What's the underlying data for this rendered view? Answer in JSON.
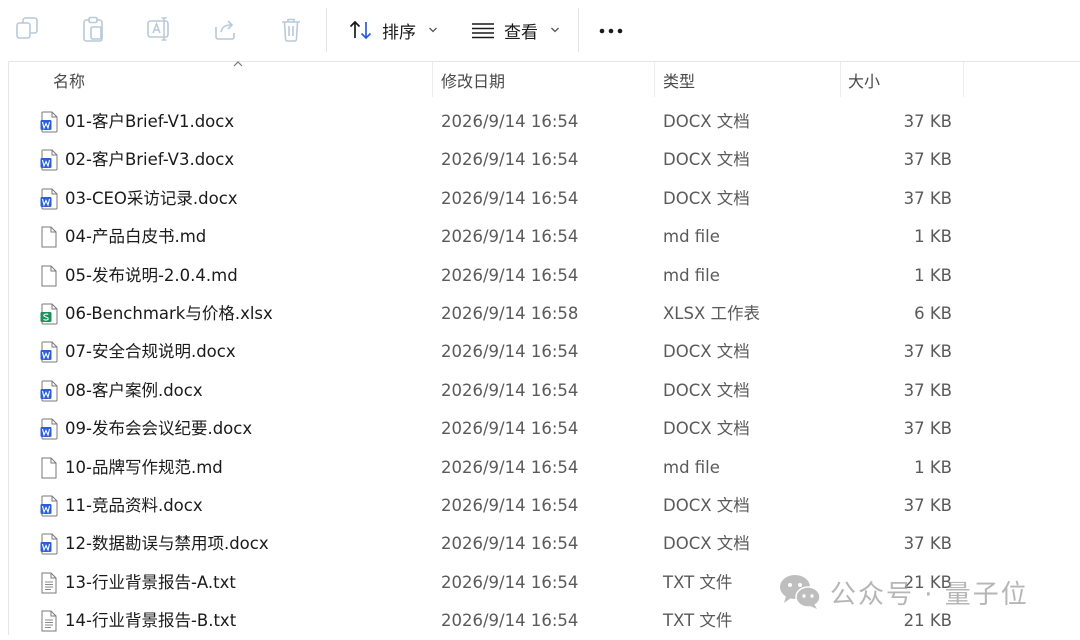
{
  "toolbar": {
    "sort_label": "排序",
    "view_label": "查看"
  },
  "columns": {
    "name": "名称",
    "modified": "修改日期",
    "type": "类型",
    "size": "大小"
  },
  "files": [
    {
      "name": "01-客户Brief-V1.docx",
      "modified": "2026/9/14 16:54",
      "type": "DOCX 文档",
      "size": "37 KB",
      "icon": "word-doc-icon"
    },
    {
      "name": "02-客户Brief-V3.docx",
      "modified": "2026/9/14 16:54",
      "type": "DOCX 文档",
      "size": "37 KB",
      "icon": "word-doc-icon"
    },
    {
      "name": "03-CEO采访记录.docx",
      "modified": "2026/9/14 16:54",
      "type": "DOCX 文档",
      "size": "37 KB",
      "icon": "word-doc-icon"
    },
    {
      "name": "04-产品白皮书.md",
      "modified": "2026/9/14 16:54",
      "type": "md file",
      "size": "1 KB",
      "icon": "blank-file-icon"
    },
    {
      "name": "05-发布说明-2.0.4.md",
      "modified": "2026/9/14 16:54",
      "type": "md file",
      "size": "1 KB",
      "icon": "blank-file-icon"
    },
    {
      "name": "06-Benchmark与价格.xlsx",
      "modified": "2026/9/14 16:58",
      "type": "XLSX 工作表",
      "size": "6 KB",
      "icon": "spreadsheet-icon"
    },
    {
      "name": "07-安全合规说明.docx",
      "modified": "2026/9/14 16:54",
      "type": "DOCX 文档",
      "size": "37 KB",
      "icon": "word-doc-icon"
    },
    {
      "name": "08-客户案例.docx",
      "modified": "2026/9/14 16:54",
      "type": "DOCX 文档",
      "size": "37 KB",
      "icon": "word-doc-icon"
    },
    {
      "name": "09-发布会会议纪要.docx",
      "modified": "2026/9/14 16:54",
      "type": "DOCX 文档",
      "size": "37 KB",
      "icon": "word-doc-icon"
    },
    {
      "name": "10-品牌写作规范.md",
      "modified": "2026/9/14 16:54",
      "type": "md file",
      "size": "1 KB",
      "icon": "blank-file-icon"
    },
    {
      "name": "11-竞品资料.docx",
      "modified": "2026/9/14 16:54",
      "type": "DOCX 文档",
      "size": "37 KB",
      "icon": "word-doc-icon"
    },
    {
      "name": "12-数据勘误与禁用项.docx",
      "modified": "2026/9/14 16:54",
      "type": "DOCX 文档",
      "size": "37 KB",
      "icon": "word-doc-icon"
    },
    {
      "name": "13-行业背景报告-A.txt",
      "modified": "2026/9/14 16:54",
      "type": "TXT 文件",
      "size": "21 KB",
      "icon": "text-file-icon"
    },
    {
      "name": "14-行业背景报告-B.txt",
      "modified": "2026/9/14 16:54",
      "type": "TXT 文件",
      "size": "21 KB",
      "icon": "text-file-icon"
    }
  ],
  "watermark": {
    "text": "公众号 · 量子位"
  },
  "colors": {
    "word_blue": "#2b5fd9",
    "sheet_green": "#1d8f5a",
    "disabled_icon": "#b8c9d9"
  }
}
